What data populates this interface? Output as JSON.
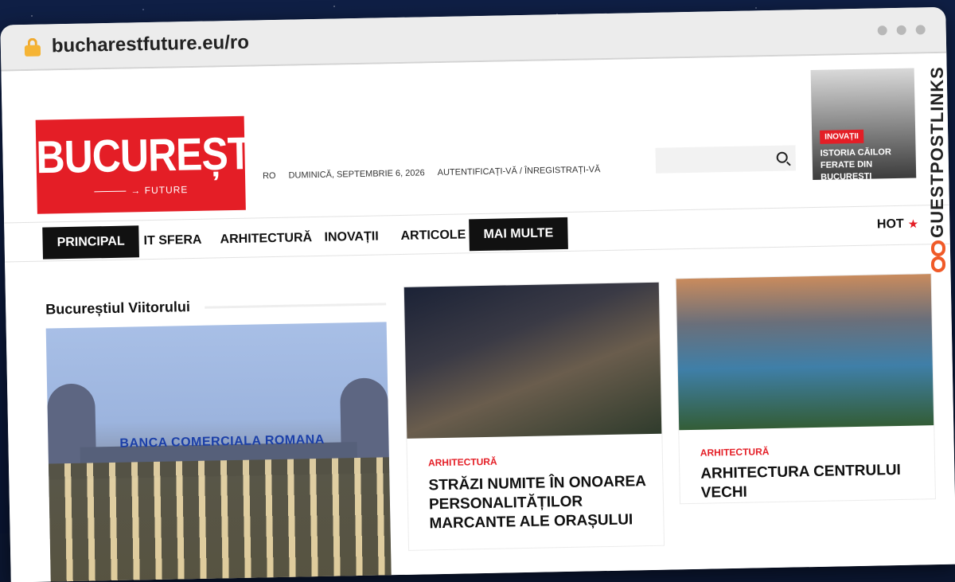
{
  "browser": {
    "url": "bucharestfuture.eu/ro"
  },
  "logo": {
    "title": "BUCUREȘTI",
    "subtitle": "FUTURE"
  },
  "topbar": {
    "lang": "RO",
    "date": "DUMINICĂ, SEPTEMBRIE 6, 2026",
    "auth": "AUTENTIFICAȚI-VĂ / ÎNREGISTRAȚI-VĂ"
  },
  "promo": {
    "tag": "INOVAȚII",
    "title": "ISTORIA CĂILOR FERATE DIN BUCUREȘTI"
  },
  "nav": {
    "items": [
      "PRINCIPAL",
      "IT SFERA",
      "ARHITECTURĂ",
      "INOVAȚII",
      "ARTICOLE",
      "MAI MULTE"
    ],
    "hot": "HOT"
  },
  "main": {
    "section_title": "Bucureștiul Viitorului",
    "hero_sign": "BANCA COMERCIALA ROMANA",
    "cards": [
      {
        "category": "ARHITECTURĂ",
        "title": "STRĂZI NUMITE ÎN ONOAREA PERSONALITĂȚILOR MARCANTE ALE ORAȘULUI"
      },
      {
        "category": "ARHITECTURĂ",
        "title": "ARHITECTURA CENTRULUI VECHI"
      }
    ]
  },
  "watermark": {
    "text": "GUESTPOSTLINKS"
  },
  "colors": {
    "brand_red": "#e41e26",
    "nav_active": "#111111",
    "watermark_orange": "#f05a28"
  }
}
